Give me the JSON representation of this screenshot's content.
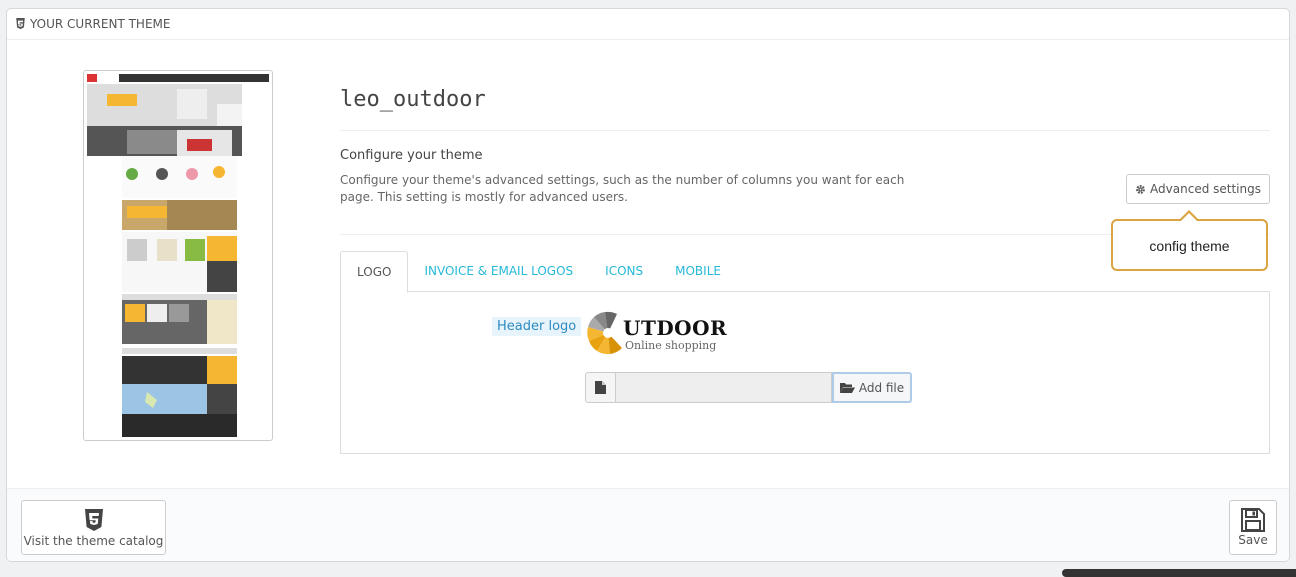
{
  "panel": {
    "title": "YOUR CURRENT THEME"
  },
  "theme": {
    "name": "leo_outdoor",
    "configure_title": "Configure your theme",
    "configure_desc": "Configure your theme's advanced settings, such as the number of columns you want for each page. This setting is mostly for advanced users.",
    "advanced_label": "Advanced settings"
  },
  "callout": {
    "text": "config theme"
  },
  "tabs": [
    {
      "label": "LOGO",
      "active": true
    },
    {
      "label": "INVOICE & EMAIL LOGOS",
      "active": false
    },
    {
      "label": "ICONS",
      "active": false
    },
    {
      "label": "MOBILE",
      "active": false
    }
  ],
  "logo_tab": {
    "header_logo_label": "Header logo",
    "logo_text": "UTDOOR",
    "logo_sub": "Online shopping",
    "add_file_label": "Add file"
  },
  "footer": {
    "catalog_label": "Visit the theme catalog",
    "save_label": "Save"
  },
  "colors": {
    "accent": "#25b9d7",
    "callout_border": "#d9a441",
    "thumb_yellow": "#f5b731"
  }
}
